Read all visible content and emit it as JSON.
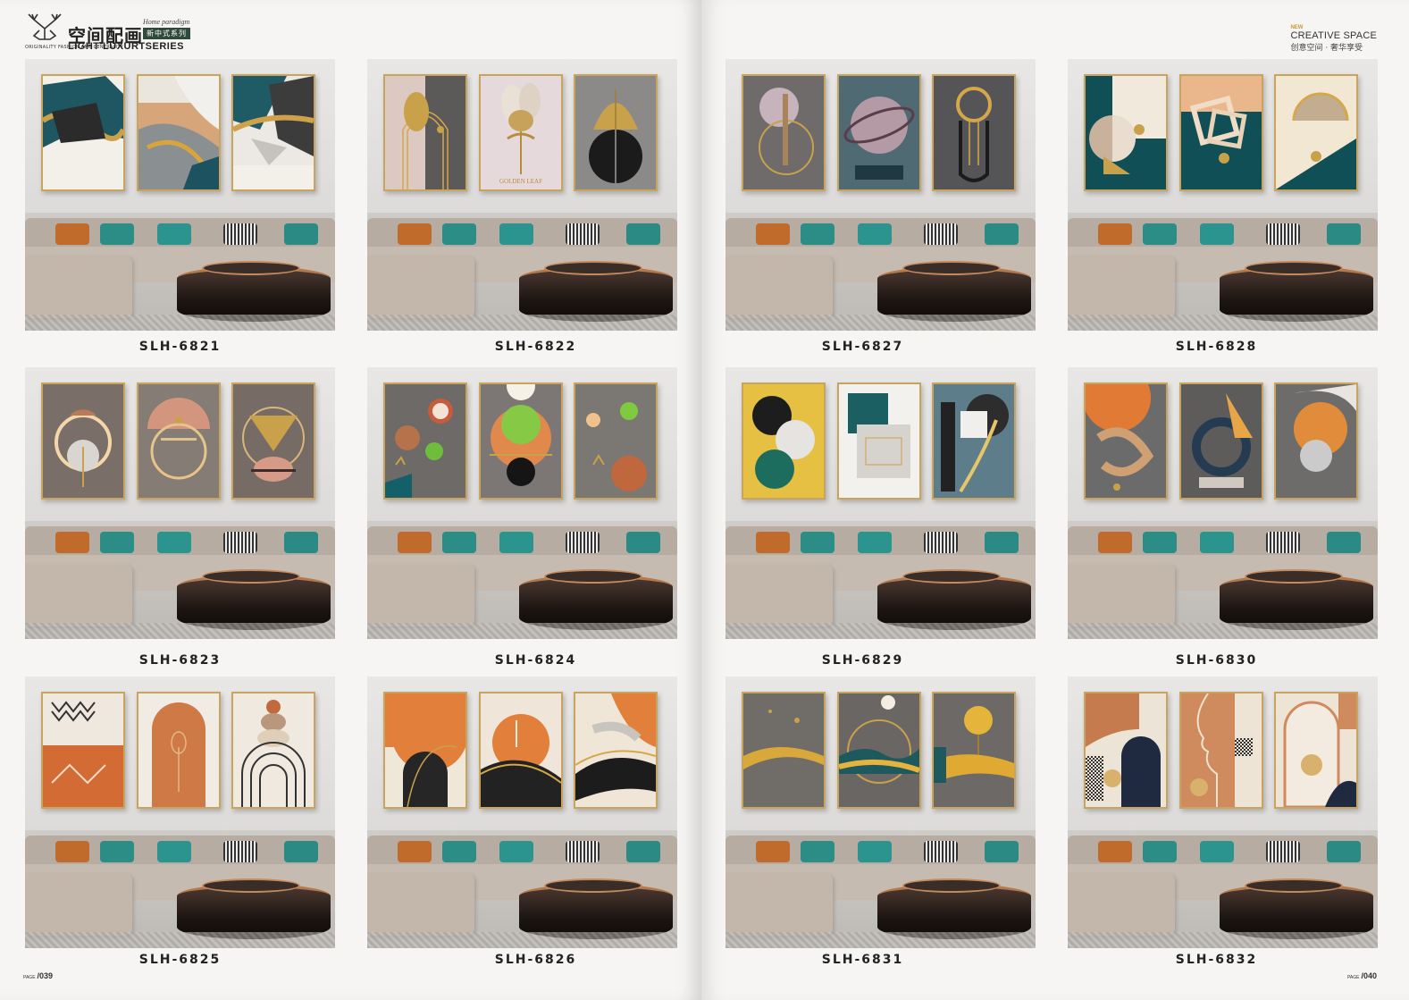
{
  "header_left": {
    "brand_cn": "空间配画",
    "home_paradigm": "Home paradigm",
    "badge": "新中式系列",
    "series": "LIGHT LUXURTSERIES",
    "logo_small": "ORIGINALITY FASHION AND CENTRALITY"
  },
  "header_right": {
    "new": "NEW",
    "title": "CREATIVE SPACE",
    "subtitle": "创意空间 · 奢华享受"
  },
  "pages": {
    "left": {
      "prefix": "PAGE",
      "number": "/039"
    },
    "right": {
      "prefix": "PAGE",
      "number": "/040"
    }
  },
  "products": [
    {
      "code": "SLH-6821"
    },
    {
      "code": "SLH-6822"
    },
    {
      "code": "SLH-6827"
    },
    {
      "code": "SLH-6828"
    },
    {
      "code": "SLH-6823"
    },
    {
      "code": "SLH-6824"
    },
    {
      "code": "SLH-6829"
    },
    {
      "code": "SLH-6830"
    },
    {
      "code": "SLH-6825"
    },
    {
      "code": "SLH-6826"
    },
    {
      "code": "SLH-6831"
    },
    {
      "code": "SLH-6832"
    }
  ],
  "painting_texts": {
    "golden_leaf": "GOLDEN LEAF"
  },
  "colors": {
    "gold": "#c9a45e",
    "teal": "#1f5b5e",
    "orange": "#d1743a",
    "gray": "#7a7875"
  }
}
